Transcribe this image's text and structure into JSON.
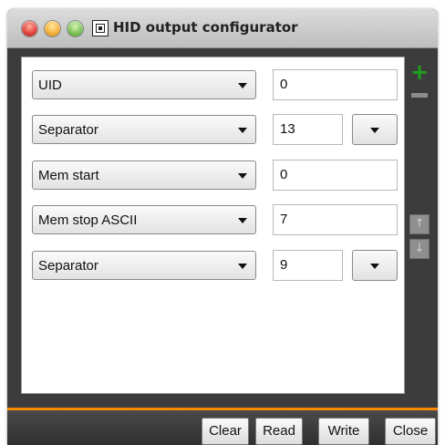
{
  "window": {
    "title": "HID output configurator"
  },
  "rows": [
    {
      "field": "UID",
      "value": "0",
      "has_dropdown": false
    },
    {
      "field": "Separator",
      "value": "13",
      "has_dropdown": true
    },
    {
      "field": "Mem start",
      "value": "0",
      "has_dropdown": false
    },
    {
      "field": "Mem stop ASCII",
      "value": "7",
      "has_dropdown": false
    },
    {
      "field": "Separator",
      "value": "9",
      "has_dropdown": true
    }
  ],
  "side_controls": {
    "add_icon": "plus-icon",
    "remove_icon": "minus-icon",
    "move_up_icon": "arrow-up-icon",
    "move_down_icon": "arrow-down-icon",
    "add_symbol": "+",
    "up_symbol": "↑",
    "down_symbol": "↓"
  },
  "buttons": {
    "clear": "Clear",
    "read": "Read",
    "write": "Write",
    "close": "Close"
  },
  "colors": {
    "accent_orange": "#ff8a00",
    "add_green": "#1ea11e",
    "window_dark": "#3c3c3c"
  }
}
